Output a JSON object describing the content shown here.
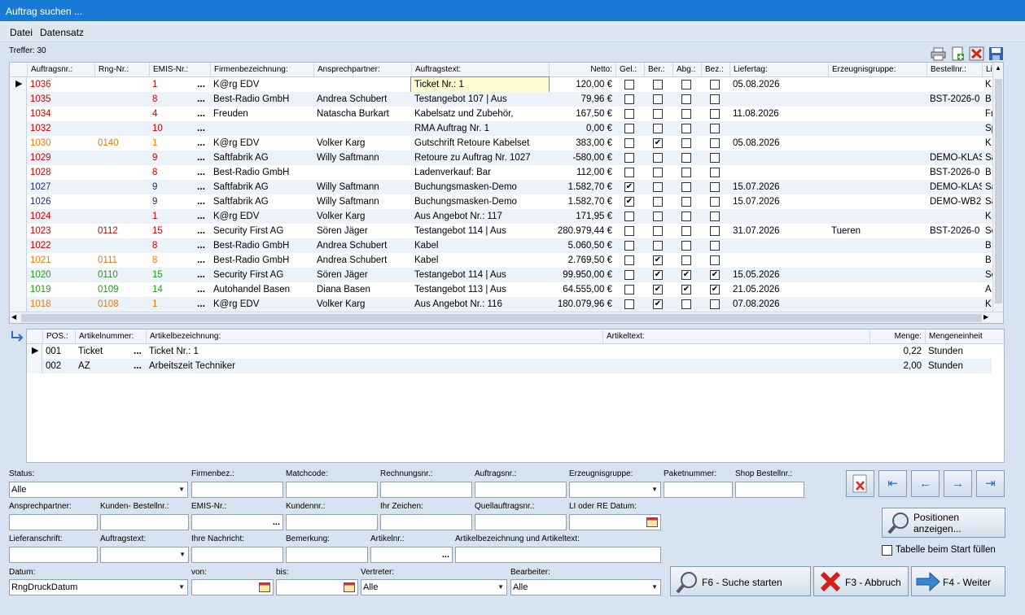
{
  "window": {
    "title": "Auftrag suchen ..."
  },
  "menu": [
    {
      "label": "Datei"
    },
    {
      "label": "Datensatz"
    }
  ],
  "hits": "Treffer: 30",
  "colors": {
    "red": "#cc0000",
    "orange": "#f07800",
    "green": "#1f9c12",
    "navy": "#1a2f6a"
  },
  "grid": {
    "columns": [
      "Auftragsnr.:",
      "Rng-Nr.:",
      "EMIS-Nr.:",
      "Firmenbezeichnung:",
      "Ansprechpartner:",
      "Auftragstext:",
      "Netto:",
      "Gel.:",
      "Ber.:",
      "Abg.:",
      "Bez.:",
      "Liefertag:",
      "Erzeugnisgruppe:",
      "Bestellnr.:",
      "Li"
    ],
    "rows": [
      {
        "nr": "1036",
        "rng": "",
        "emis": "1",
        "firma": "K@rg EDV",
        "ansp": "",
        "text": "Ticket Nr.: 1",
        "netto": "120,00 €",
        "gel": false,
        "ber": false,
        "abg": false,
        "bez": false,
        "liefer": "05.08.2026",
        "erz": "",
        "best": "",
        "li": "K",
        "color": "red",
        "selected": true
      },
      {
        "nr": "1035",
        "rng": "",
        "emis": "8",
        "firma": "Best-Radio GmbH",
        "ansp": "Andrea Schubert",
        "text": "Testangebot 107 | Aus",
        "netto": "79,96 €",
        "gel": false,
        "ber": false,
        "abg": false,
        "bez": false,
        "liefer": "",
        "erz": "",
        "best": "BST-2026-0",
        "li": "B",
        "color": "red"
      },
      {
        "nr": "1034",
        "rng": "",
        "emis": "4",
        "firma": "Freuden",
        "ansp": "Natascha Burkart",
        "text": "Kabelsatz und Zubehör,",
        "netto": "167,50 €",
        "gel": false,
        "ber": false,
        "abg": false,
        "bez": false,
        "liefer": "11.08.2026",
        "erz": "",
        "best": "",
        "li": "Fr",
        "color": "red"
      },
      {
        "nr": "1032",
        "rng": "",
        "emis": "10",
        "firma": "",
        "ansp": "",
        "text": "RMA Auftrag Nr. 1",
        "netto": "0,00 €",
        "gel": false,
        "ber": false,
        "abg": false,
        "bez": false,
        "liefer": "",
        "erz": "",
        "best": "",
        "li": "Sp",
        "color": "red"
      },
      {
        "nr": "1030",
        "rng": "0140",
        "emis": "1",
        "firma": "K@rg EDV",
        "ansp": "Volker Karg",
        "text": "Gutschrift Retoure Kabelset",
        "netto": "383,00 €",
        "gel": false,
        "ber": true,
        "abg": false,
        "bez": false,
        "liefer": "05.08.2026",
        "erz": "",
        "best": "",
        "li": "K",
        "color": "orange"
      },
      {
        "nr": "1029",
        "rng": "",
        "emis": "9",
        "firma": "Saftfabrik AG",
        "ansp": "Willy Saftmann",
        "text": "Retoure zu Auftrag Nr. 1027",
        "netto": "-580,00 €",
        "gel": false,
        "ber": false,
        "abg": false,
        "bez": false,
        "liefer": "",
        "erz": "",
        "best": "DEMO-KLAS",
        "li": "Sa",
        "color": "red"
      },
      {
        "nr": "1028",
        "rng": "",
        "emis": "8",
        "firma": "Best-Radio GmbH",
        "ansp": "",
        "text": "Ladenverkauf: Bar",
        "netto": "112,00 €",
        "gel": false,
        "ber": false,
        "abg": false,
        "bez": false,
        "liefer": "",
        "erz": "",
        "best": "BST-2026-0",
        "li": "B",
        "color": "red"
      },
      {
        "nr": "1027",
        "rng": "",
        "emis": "9",
        "firma": "Saftfabrik AG",
        "ansp": "Willy Saftmann",
        "text": "Buchungsmasken-Demo",
        "netto": "1.582,70 €",
        "gel": true,
        "ber": false,
        "abg": false,
        "bez": false,
        "liefer": "15.07.2026",
        "erz": "",
        "best": "DEMO-KLAS",
        "li": "Sa",
        "color": "navy"
      },
      {
        "nr": "1026",
        "rng": "",
        "emis": "9",
        "firma": "Saftfabrik AG",
        "ansp": "Willy Saftmann",
        "text": "Buchungsmasken-Demo",
        "netto": "1.582,70 €",
        "gel": true,
        "ber": false,
        "abg": false,
        "bez": false,
        "liefer": "15.07.2026",
        "erz": "",
        "best": "DEMO-WB2",
        "li": "Sa",
        "color": "navy"
      },
      {
        "nr": "1024",
        "rng": "",
        "emis": "1",
        "firma": "K@rg EDV",
        "ansp": "Volker Karg",
        "text": "Aus Angebot Nr.: 117",
        "netto": "171,95 €",
        "gel": false,
        "ber": false,
        "abg": false,
        "bez": false,
        "liefer": "",
        "erz": "",
        "best": "",
        "li": "K",
        "color": "red"
      },
      {
        "nr": "1023",
        "rng": "0112",
        "emis": "15",
        "firma": "Security First AG",
        "ansp": "Sören Jäger",
        "text": "Testangebot 114 | Aus",
        "netto": "280.979,44 €",
        "gel": false,
        "ber": false,
        "abg": false,
        "bez": false,
        "liefer": "31.07.2026",
        "erz": "Tueren",
        "best": "BST-2026-0",
        "li": "Se",
        "color": "red"
      },
      {
        "nr": "1022",
        "rng": "",
        "emis": "8",
        "firma": "Best-Radio GmbH",
        "ansp": "Andrea Schubert",
        "text": "Kabel",
        "netto": "5.060,50 €",
        "gel": false,
        "ber": false,
        "abg": false,
        "bez": false,
        "liefer": "",
        "erz": "",
        "best": "",
        "li": "B",
        "color": "red"
      },
      {
        "nr": "1021",
        "rng": "0111",
        "emis": "8",
        "firma": "Best-Radio GmbH",
        "ansp": "Andrea Schubert",
        "text": "Kabel",
        "netto": "2.769,50 €",
        "gel": false,
        "ber": true,
        "abg": false,
        "bez": false,
        "liefer": "",
        "erz": "",
        "best": "",
        "li": "B",
        "color": "orange"
      },
      {
        "nr": "1020",
        "rng": "0110",
        "emis": "15",
        "firma": "Security First AG",
        "ansp": "Sören Jäger",
        "text": "Testangebot 114 | Aus",
        "netto": "99.950,00 €",
        "gel": false,
        "ber": true,
        "abg": true,
        "bez": true,
        "liefer": "15.05.2026",
        "erz": "",
        "best": "",
        "li": "Se",
        "color": "green"
      },
      {
        "nr": "1019",
        "rng": "0109",
        "emis": "14",
        "firma": "Autohandel Basen",
        "ansp": "Diana Basen",
        "text": "Testangebot 113 | Aus",
        "netto": "64.555,00 €",
        "gel": false,
        "ber": true,
        "abg": true,
        "bez": true,
        "liefer": "21.05.2026",
        "erz": "",
        "best": "",
        "li": "A",
        "color": "green"
      },
      {
        "nr": "1018",
        "rng": "0108",
        "emis": "1",
        "firma": "K@rg EDV",
        "ansp": "Volker Karg",
        "text": "Aus Angebot Nr.: 116",
        "netto": "180.079,96 €",
        "gel": false,
        "ber": true,
        "abg": false,
        "bez": false,
        "liefer": "07.08.2026",
        "erz": "",
        "best": "",
        "li": "K",
        "color": "orange"
      }
    ]
  },
  "positions": {
    "columns": [
      "POS.:",
      "Artikelnummer:",
      "Artikelbezeichnung:",
      "Artikeltext:",
      "Menge:",
      "Mengeneinheit"
    ],
    "rows": [
      {
        "pos": "001",
        "artnr": "Ticket",
        "bez": "Ticket Nr.: 1",
        "text": "",
        "menge": "0,22",
        "einheit": "Stunden",
        "selected": true
      },
      {
        "pos": "002",
        "artnr": "AZ",
        "bez": "Arbeitszeit Techniker",
        "text": "",
        "menge": "2,00",
        "einheit": "Stunden"
      }
    ]
  },
  "filters": {
    "status_label": "Status:",
    "status_value": "Alle",
    "firmenbez": "Firmenbez.:",
    "matchcode": "Matchcode:",
    "rechnungsnr": "Rechnungsnr.:",
    "auftragsnr": "Auftragsnr.:",
    "erzeugnisgruppe": "Erzeugnisgruppe:",
    "paketnummer": "Paketnummer:",
    "shop_bestellnr": "Shop Bestellnr.:",
    "ansprechpartner": "Ansprechpartner:",
    "kunden_bestellnr": "Kunden- Bestellnr.:",
    "emis_nr": "EMIS-Nr.:",
    "kundennr": "Kundennr.:",
    "ihr_zeichen": "Ihr Zeichen:",
    "quellauftragsnr": "Quellauftragsnr.:",
    "li_re_datum": "LI oder RE Datum:",
    "lieferanschrift": "Lieferanschrift:",
    "auftragstext": "Auftragstext:",
    "ihre_nachricht": "Ihre Nachricht:",
    "bemerkung": "Bemerkung:",
    "artikelnr": "Artikelnr.:",
    "artikel_bez_text": "Artikelbezeichnung und Artikeltext:",
    "datum_label": "Datum:",
    "datum_value": "RngDruckDatum",
    "von": "von:",
    "bis": "bis:",
    "vertreter_label": "Vertreter:",
    "vertreter_value": "Alle",
    "bearbeiter_label": "Bearbeiter:",
    "bearbeiter_value": "Alle",
    "fill_on_start": "Tabelle beim Start füllen"
  },
  "buttons": {
    "positions": "Positionen anzeigen...",
    "search": "F6 - Suche starten",
    "cancel": "F3 - Abbruch",
    "next": "F4 - Weiter"
  },
  "dots": "..."
}
